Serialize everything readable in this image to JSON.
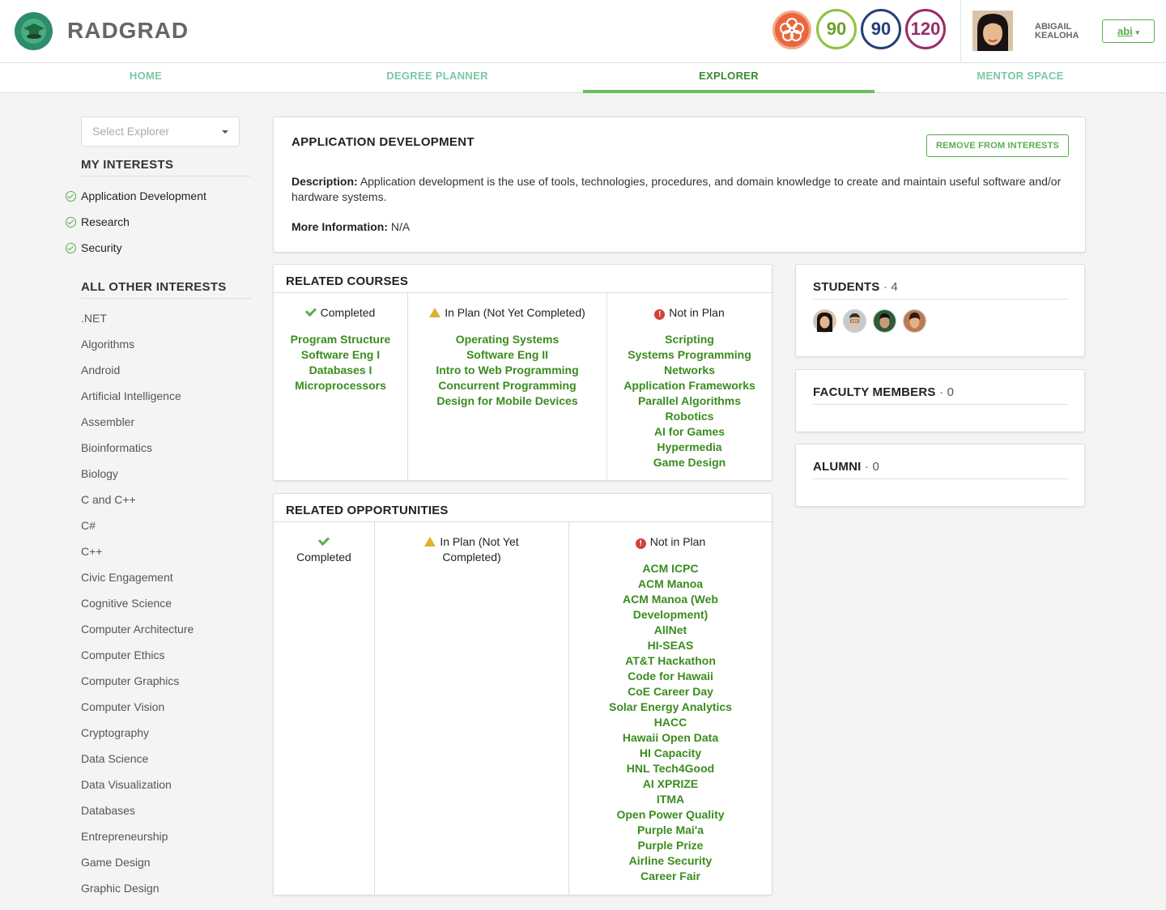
{
  "header": {
    "brand": "RADGRAD",
    "scores": [
      "90",
      "90",
      "120"
    ],
    "user_name": "ABIGAIL KEALOHA",
    "user_button": "abi"
  },
  "nav": [
    "HOME",
    "DEGREE PLANNER",
    "EXPLORER",
    "MENTOR SPACE"
  ],
  "sidebar": {
    "select_placeholder": "Select Explorer",
    "my_interests_title": "MY INTERESTS",
    "my_interests": [
      "Application Development",
      "Research",
      "Security"
    ],
    "other_interests_title": "ALL OTHER INTERESTS",
    "other_interests": [
      ".NET",
      "Algorithms",
      "Android",
      "Artificial Intelligence",
      "Assembler",
      "Bioinformatics",
      "Biology",
      "C and C++",
      "C#",
      "C++",
      "Civic Engagement",
      "Cognitive Science",
      "Computer Architecture",
      "Computer Ethics",
      "Computer Graphics",
      "Computer Vision",
      "Cryptography",
      "Data Science",
      "Data Visualization",
      "Databases",
      "Entrepreneurship",
      "Game Design",
      "Graphic Design"
    ]
  },
  "interest": {
    "title": "APPLICATION DEVELOPMENT",
    "remove_button": "REMOVE FROM INTERESTS",
    "description_label": "Description:",
    "description": "Application development is the use of tools, technologies, procedures, and domain knowledge to create and maintain useful software and/or hardware systems.",
    "more_label": "More Information:",
    "more": "N/A"
  },
  "courses": {
    "title": "RELATED COURSES",
    "completed_label": "Completed",
    "in_plan_label": "In Plan (Not Yet Completed)",
    "not_in_plan_label": "Not in Plan",
    "completed": [
      "Program Structure",
      "Software Eng I",
      "Databases I",
      "Microprocessors"
    ],
    "in_plan": [
      "Operating Systems",
      "Software Eng II",
      "Intro to Web Programming",
      "Concurrent Programming",
      "Design for Mobile Devices"
    ],
    "not_in_plan": [
      "Scripting",
      "Systems Programming",
      "Networks",
      "Application Frameworks",
      "Parallel Algorithms",
      "Robotics",
      "AI for Games",
      "Hypermedia",
      "Game Design"
    ]
  },
  "opportunities": {
    "title": "RELATED OPPORTUNITIES",
    "completed_label": "Completed",
    "in_plan_label": "In Plan (Not Yet Completed)",
    "not_in_plan_label": "Not in Plan",
    "not_in_plan": [
      "ACM ICPC",
      "ACM Manoa",
      "ACM Manoa (Web Development)",
      "AllNet",
      "HI-SEAS",
      "AT&T Hackathon",
      "Code for Hawaii",
      "CoE Career Day",
      "Solar Energy Analytics",
      "HACC",
      "Hawaii Open Data",
      "HI Capacity",
      "HNL Tech4Good",
      "AI XPRIZE",
      "ITMA",
      "Open Power Quality",
      "Purple Mai'a",
      "Purple Prize",
      "Airline Security",
      "Career Fair"
    ]
  },
  "students": {
    "title": "STUDENTS",
    "count": "· 4"
  },
  "faculty": {
    "title": "FACULTY MEMBERS",
    "count": "· 0"
  },
  "alumni": {
    "title": "ALUMNI",
    "count": "· 0"
  }
}
